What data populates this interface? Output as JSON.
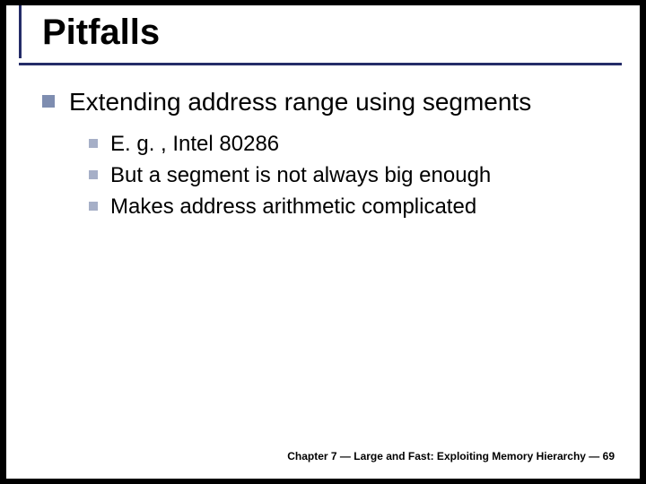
{
  "title": "Pitfalls",
  "bullets": {
    "level1": "Extending address range using segments",
    "level2": [
      "E. g. , Intel 80286",
      "But a segment is not always big enough",
      "Makes address arithmetic complicated"
    ]
  },
  "footer": "Chapter 7 — Large and Fast: Exploiting Memory Hierarchy — 69"
}
